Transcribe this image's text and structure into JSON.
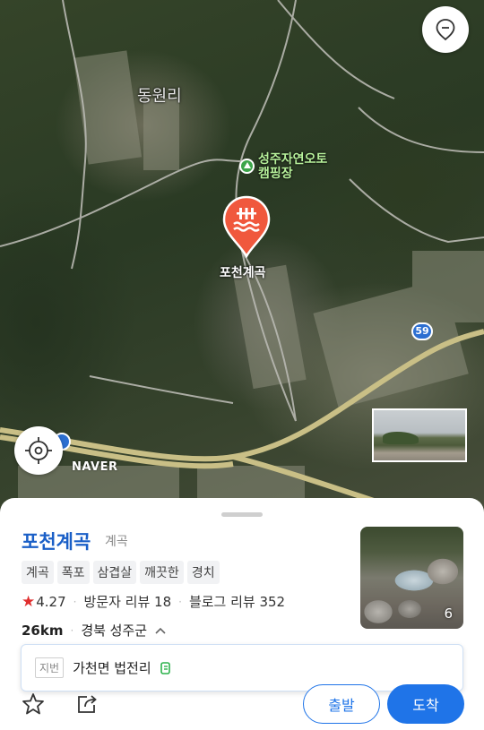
{
  "map": {
    "village_label": "동원리",
    "campsite_label_line1": "성주자연오토",
    "campsite_label_line2": "캠핑장",
    "pin_label": "포천계곡",
    "route_number": "59",
    "logo": "NAVER",
    "icons": {
      "location": "location-pin-icon",
      "gps": "crosshair-icon",
      "campsite": "campsite-icon",
      "pin": "waterfall-icon"
    }
  },
  "place": {
    "name": "포천계곡",
    "category": "계곡",
    "tags": [
      "계곡",
      "폭포",
      "삼겹살",
      "깨끗한",
      "경치"
    ],
    "rating": "4.27",
    "visitor_reviews": "방문자 리뷰 18",
    "blog_reviews": "블로그 리뷰 352",
    "distance": "26km",
    "region": "경북 성주군",
    "photo_count": "6",
    "address_badge": "지번",
    "address": "가천면 법전리"
  },
  "actions": {
    "depart_label": "출발",
    "arrive_label": "도착"
  },
  "colors": {
    "accent": "#1f74e8",
    "title": "#1a5fc7",
    "pin": "#f0583d",
    "star": "#e02e2e",
    "campsite": "#3ca54a"
  }
}
